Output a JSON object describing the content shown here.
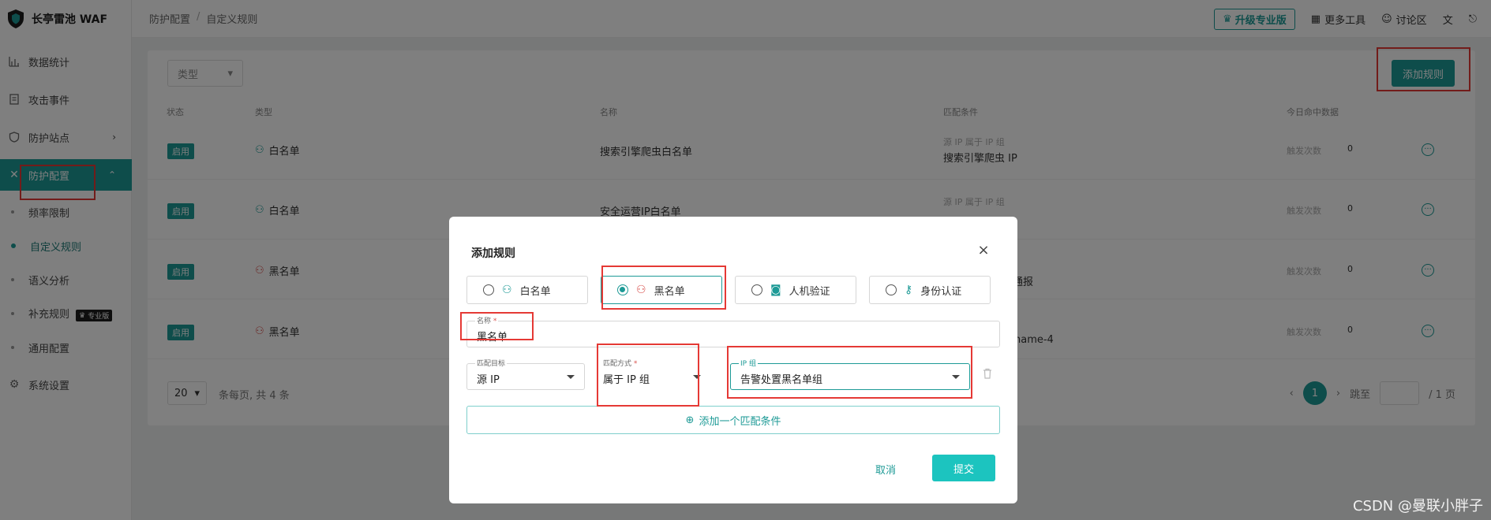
{
  "app": {
    "name": "长亭雷池 WAF"
  },
  "breadcrumb": [
    "防护配置",
    "自定义规则"
  ],
  "topbar": {
    "upgrade": "升级专业版",
    "more_tools": "更多工具",
    "forum": "讨论区"
  },
  "sidebar": {
    "items": [
      {
        "label": "数据统计",
        "icon": "bar-chart-icon"
      },
      {
        "label": "攻击事件",
        "icon": "document-icon"
      },
      {
        "label": "防护站点",
        "icon": "shield-icon"
      },
      {
        "label": "防护配置",
        "icon": "close-x-icon"
      },
      {
        "label": "系统设置",
        "icon": "gear-icon"
      }
    ],
    "sub_items": [
      "频率限制",
      "自定义规则",
      "语义分析",
      "补充规则",
      "通用配置"
    ],
    "pro_tag": "专业版"
  },
  "list": {
    "filter_placeholder": "类型",
    "add_button": "添加规则",
    "columns": [
      "状态",
      "类型",
      "名称",
      "匹配条件",
      "今日命中数据"
    ],
    "rows": [
      {
        "status": "启用",
        "type": "白名单",
        "name": "搜索引擎爬虫白名单",
        "cond_top": "源 IP 属于 IP 组",
        "cond_bottom": "搜索引擎爬虫 IP",
        "hits_label": "触发次数",
        "hits": "0"
      },
      {
        "status": "启用",
        "type": "白名单",
        "name": "安全运营IP白名单",
        "cond_top": "源 IP 属于 IP 组",
        "cond_bottom": "",
        "hits_label": "触发次数",
        "hits": "0"
      },
      {
        "status": "启用",
        "type": "黑名单",
        "name": "",
        "cond_top": "",
        "cond_bottom": "通报",
        "hits_label": "触发次数",
        "hits": "0"
      },
      {
        "status": "启用",
        "type": "黑名单",
        "name": "",
        "cond_top": "",
        "cond_bottom": "name-4",
        "hits_label": "触发次数",
        "hits": "0"
      }
    ],
    "page_size": "20",
    "summary": "条每页, 共 4 条",
    "current_page": "1",
    "jump_label": "跳至",
    "total_pages": "/ 1 页"
  },
  "modal": {
    "title": "添加规则",
    "types": [
      "白名单",
      "黑名单",
      "人机验证",
      "身份认证"
    ],
    "selected_type": "黑名单",
    "name_label": "名称",
    "name_value": "黑名单",
    "target_label": "匹配目标",
    "target_value": "源 IP",
    "method_label": "匹配方式",
    "method_value": "属于 IP 组",
    "ipgroup_label": "IP 组",
    "ipgroup_value": "告警处置黑名单组",
    "add_condition": "添加一个匹配条件",
    "cancel": "取消",
    "submit": "提交"
  },
  "watermark": "CSDN @曼联小胖子",
  "colors": {
    "accent": "#1d9a96",
    "highlight": "#e53935"
  }
}
